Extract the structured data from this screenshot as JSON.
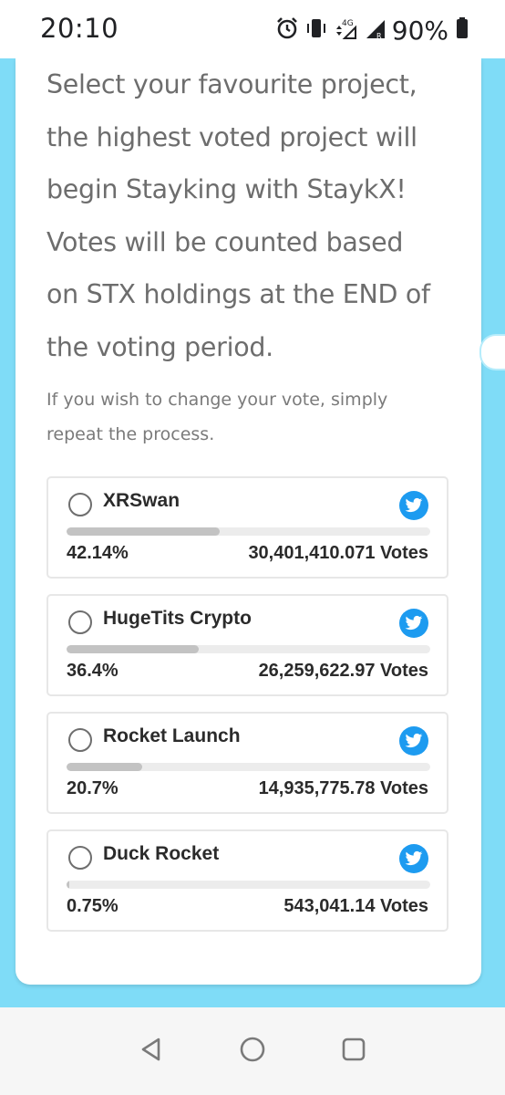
{
  "status_bar": {
    "time": "20:10",
    "battery": "90%",
    "icons": [
      "alarm-icon",
      "vibrate-icon",
      "data-4g-icon",
      "signal-icon",
      "signal-roaming-icon",
      "battery-icon"
    ]
  },
  "intro": {
    "lines": [
      "Select your favourite project,",
      "the highest voted project will",
      "begin Stayking with StaykX!",
      "Votes will be counted based",
      "on STX holdings at the END of",
      "the voting period."
    ]
  },
  "note": {
    "lines": [
      "If you wish to change your vote, simply",
      "repeat the process."
    ]
  },
  "options": [
    {
      "name": "XRSwan",
      "percent_label": "42.14%",
      "percent": 42.14,
      "votes": "30,401,410.071 Votes"
    },
    {
      "name": "HugeTits Crypto",
      "percent_label": "36.4%",
      "percent": 36.4,
      "votes": "26,259,622.97 Votes"
    },
    {
      "name": "Rocket Launch",
      "percent_label": "20.7%",
      "percent": 20.7,
      "votes": "14,935,775.78 Votes"
    },
    {
      "name": "Duck Rocket",
      "percent_label": "0.75%",
      "percent": 0.75,
      "votes": "543,041.14 Votes"
    }
  ],
  "colors": {
    "background": "#7fdcf7",
    "twitter": "#1d9bf0",
    "bar_fill": "#c3c3c3",
    "bar_track": "#ececec"
  },
  "nav_bar": {
    "icons": [
      "back-icon",
      "home-icon",
      "recents-icon"
    ]
  }
}
